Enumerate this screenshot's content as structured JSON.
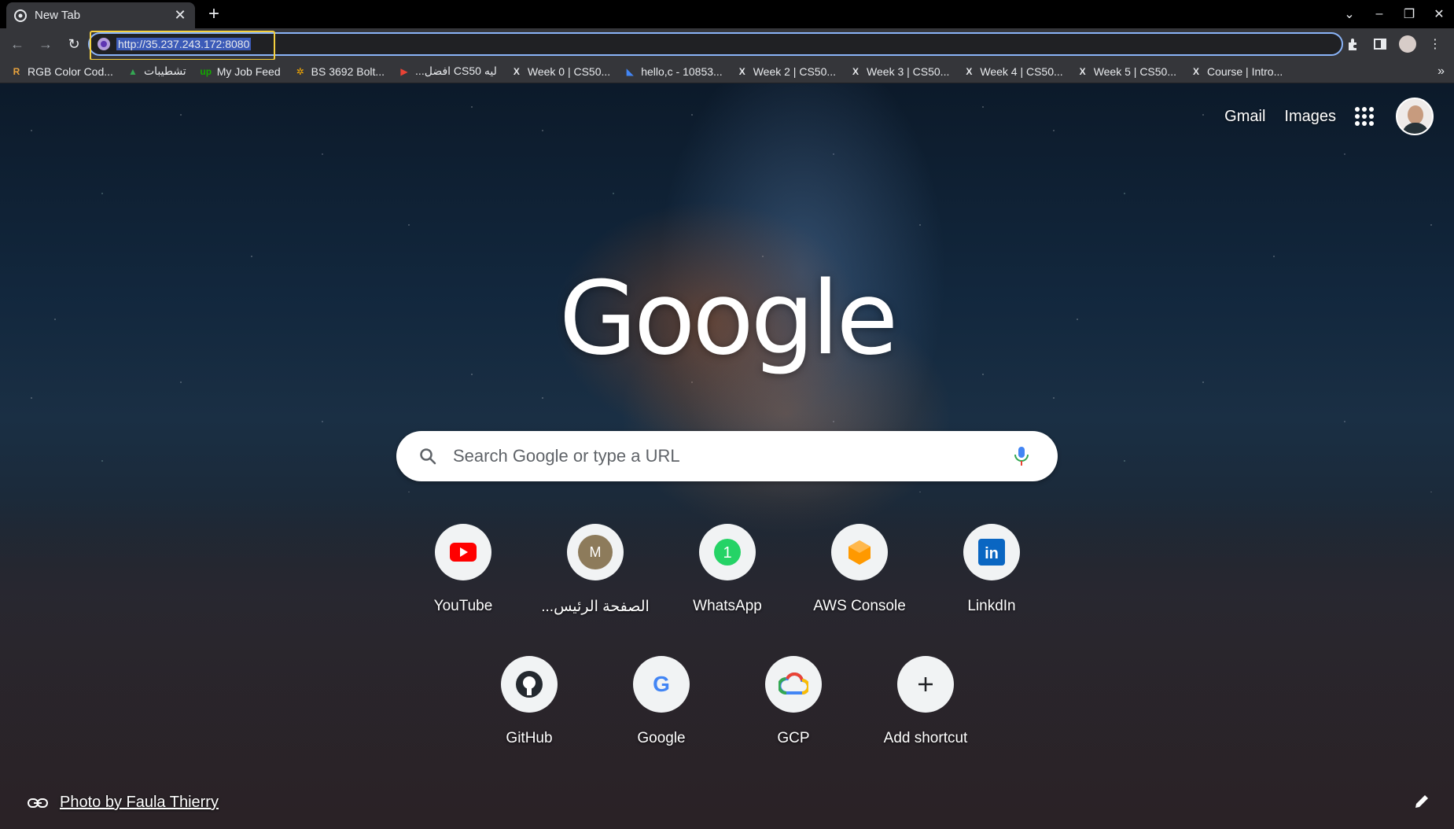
{
  "tab": {
    "title": "New Tab",
    "close": "✕"
  },
  "newtab": "+",
  "window_controls": [
    "⌄",
    "–",
    "❐",
    "✕"
  ],
  "omnibox": {
    "url": "http://35.237.243.172:8080"
  },
  "bookmarks": [
    {
      "label": "RGB Color Cod...",
      "icon": "R",
      "icon_color": "#e8a33d"
    },
    {
      "label": "تشطيبات",
      "icon": "▲",
      "icon_color": "#34a853"
    },
    {
      "label": "My Job Feed",
      "icon": "up",
      "icon_color": "#14a800"
    },
    {
      "label": "BS 3692 Bolt...",
      "icon": "✲",
      "icon_color": "#f9ab00"
    },
    {
      "label": "...افضل CS50 ليه",
      "icon": "▶",
      "icon_color": "#ea4335"
    },
    {
      "label": "Week 0 | CS50...",
      "icon": "X",
      "icon_color": "#e8eaed"
    },
    {
      "label": "hello,c - 10853...",
      "icon": "◣",
      "icon_color": "#4285f4"
    },
    {
      "label": "Week 2 | CS50...",
      "icon": "X",
      "icon_color": "#e8eaed"
    },
    {
      "label": "Week 3 | CS50...",
      "icon": "X",
      "icon_color": "#e8eaed"
    },
    {
      "label": "Week 4 | CS50...",
      "icon": "X",
      "icon_color": "#e8eaed"
    },
    {
      "label": "Week 5 | CS50...",
      "icon": "X",
      "icon_color": "#e8eaed"
    },
    {
      "label": "Course | Intro...",
      "icon": "X",
      "icon_color": "#e8eaed"
    }
  ],
  "bookmarks_more": "»",
  "ntp": {
    "gmail": "Gmail",
    "images": "Images",
    "logo": "Google",
    "search_placeholder": "Search Google or type a URL",
    "shortcuts_row1": [
      {
        "label": "YouTube",
        "icon": "youtube-icon"
      },
      {
        "label": "...الصفحة الرئيس",
        "icon": "m-letter-icon"
      },
      {
        "label": "WhatsApp",
        "icon": "whatsapp-icon"
      },
      {
        "label": "AWS Console",
        "icon": "aws-icon"
      },
      {
        "label": "LinkdIn",
        "icon": "linkedin-icon"
      }
    ],
    "shortcuts_row2": [
      {
        "label": "GitHub",
        "icon": "github-icon"
      },
      {
        "label": "Google",
        "icon": "google-icon"
      },
      {
        "label": "GCP",
        "icon": "gcp-icon"
      },
      {
        "label": "Add shortcut",
        "icon": "plus-icon"
      }
    ],
    "attribution": "Photo by Faula Thierry"
  },
  "colors": {
    "accent": "#8ab4f8",
    "highlight": "#f4d03f",
    "toolbar": "#35363a",
    "tabstrip": "#000000"
  }
}
